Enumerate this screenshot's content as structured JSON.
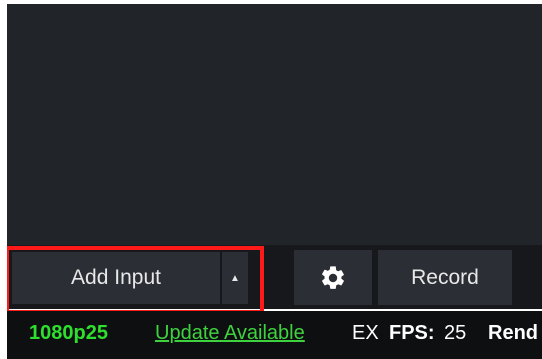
{
  "toolbar": {
    "add_input_label": "Add Input",
    "add_input_arrow": "▲",
    "settings_icon": "gear-icon",
    "record_label": "Record"
  },
  "statusbar": {
    "resolution": "1080p25",
    "update_link": "Update Available",
    "ex_label": "EX",
    "fps_label": "FPS:",
    "fps_value": "25",
    "render_label": "Rend"
  },
  "colors": {
    "preview_bg": "#212429",
    "toolbar_bg": "#16181b",
    "button_bg": "#2b2f35",
    "status_bg": "#0e0f11",
    "status_green": "#2ee02e",
    "highlight_red": "#ff1a1a"
  }
}
